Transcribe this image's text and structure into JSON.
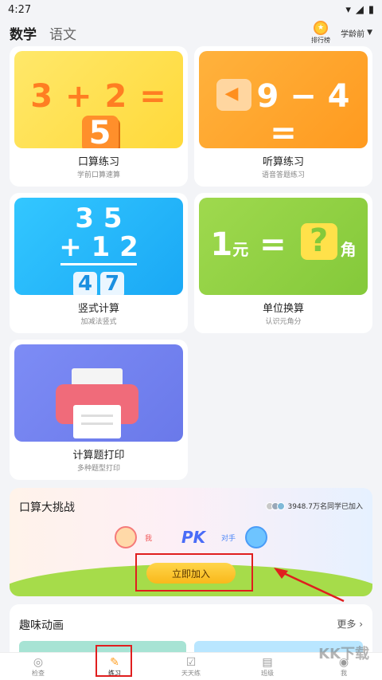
{
  "status": {
    "time": "4:27"
  },
  "header": {
    "tabs": [
      "数学",
      "语文"
    ],
    "active_tab": "数学",
    "rank_label": "排行榜",
    "age_label": "学龄前",
    "age_arrow": "▼"
  },
  "cards": [
    {
      "title": "口算练习",
      "subtitle": "学前口算速算",
      "visual": "3 + 2 = 5"
    },
    {
      "title": "听算练习",
      "subtitle": "语音答题练习",
      "visual": "9 − 4 ="
    },
    {
      "title": "竖式计算",
      "subtitle": "加减法竖式",
      "visual_top": "3 5",
      "visual_mid": "+ 1 2",
      "visual_result": [
        "4",
        "7"
      ]
    },
    {
      "title": "单位换算",
      "subtitle": "认识元角分",
      "visual_left": "1",
      "visual_unit1": "元",
      "visual_q": "?",
      "visual_unit2": "角"
    },
    {
      "title": "计算题打印",
      "subtitle": "多种题型打印"
    }
  ],
  "challenge": {
    "title": "口算大挑战",
    "count_text": "3948.7万名同学已加入",
    "me_label": "我",
    "pk_label": "PK",
    "opponent_label": "对手",
    "join_label": "立即加入"
  },
  "fun": {
    "title": "趣味动画",
    "more": "更多 ›"
  },
  "tabbar": [
    {
      "label": "检查",
      "icon": "camera-icon"
    },
    {
      "label": "练习",
      "icon": "pencil-icon"
    },
    {
      "label": "天天练",
      "icon": "calendar-check-icon"
    },
    {
      "label": "班级",
      "icon": "class-icon"
    },
    {
      "label": "我",
      "icon": "profile-icon"
    }
  ],
  "watermark": "KK下载",
  "colors": {
    "accent": "#ff9e1f",
    "annotation_red": "#e01e1e"
  }
}
